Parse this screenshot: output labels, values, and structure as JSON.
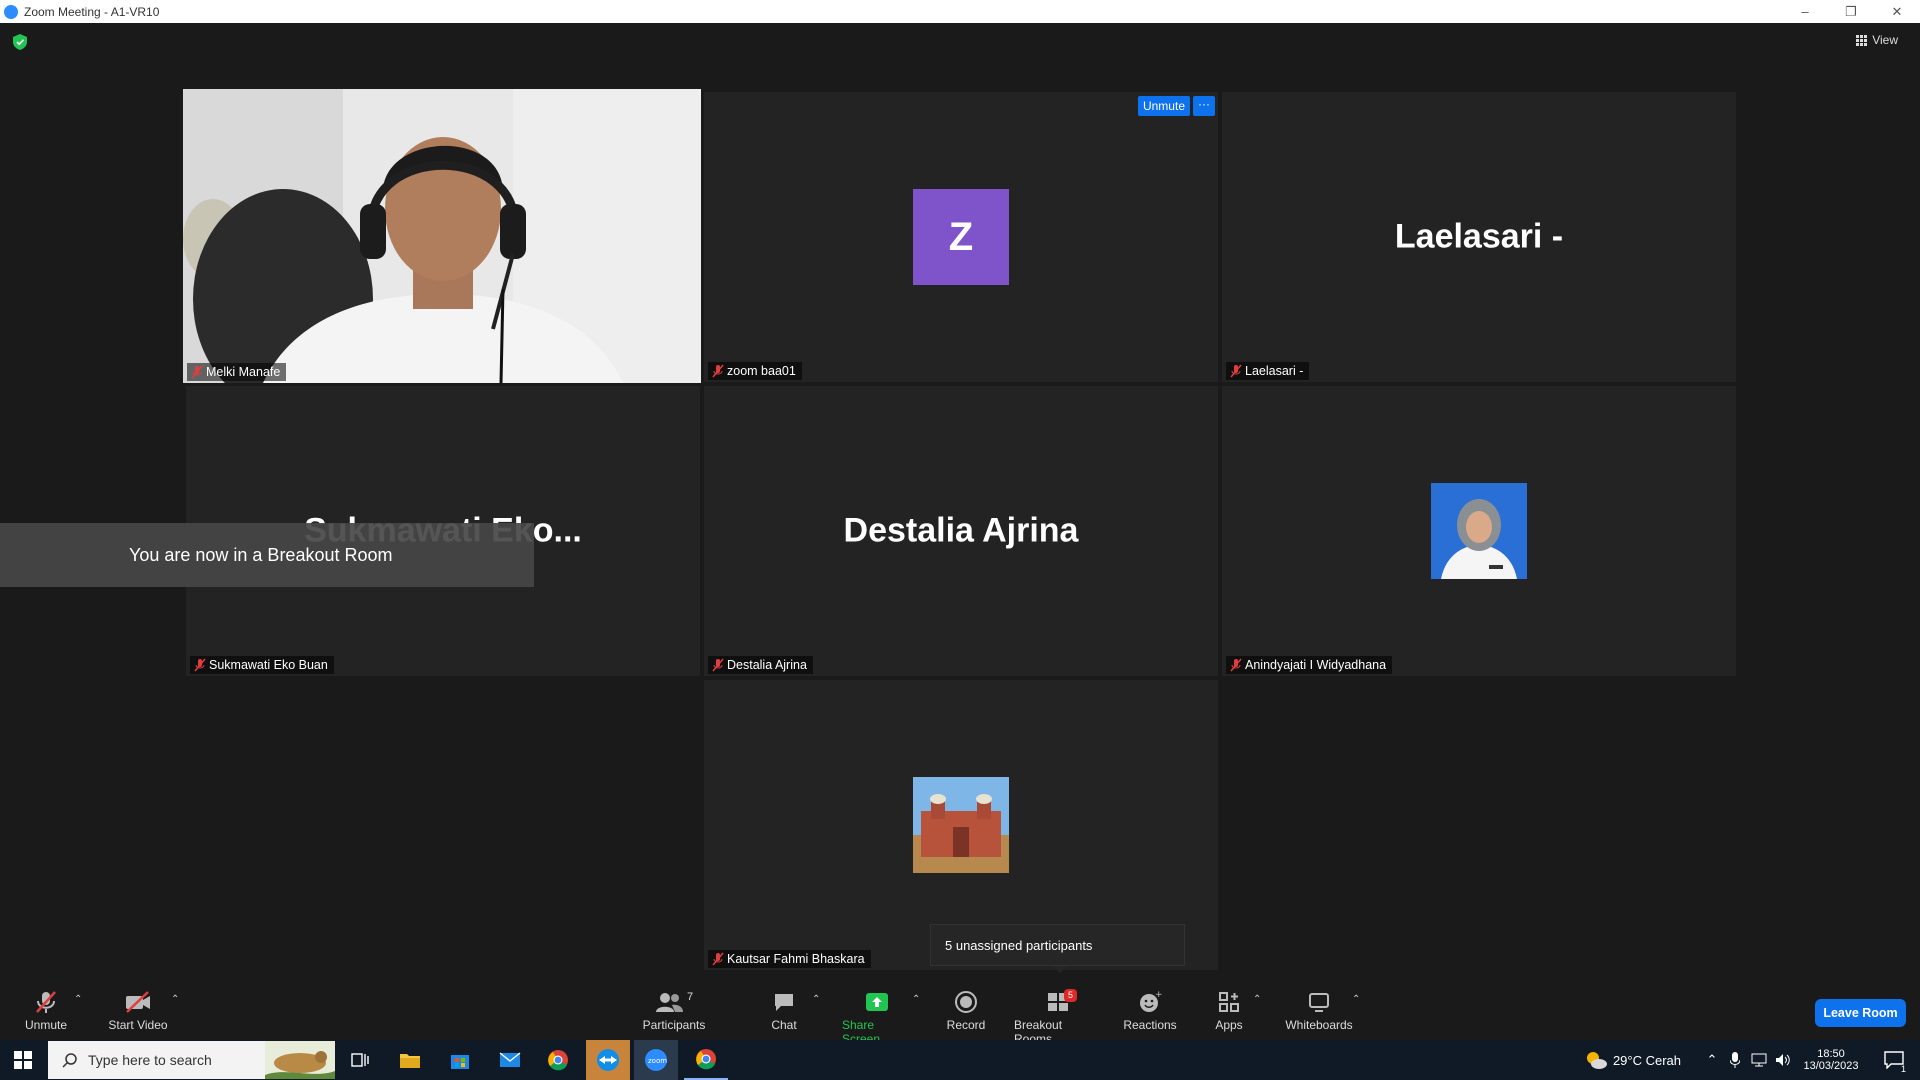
{
  "window": {
    "title": "Zoom Meeting - A1-VR10"
  },
  "topbar": {
    "view_label": "View"
  },
  "tiles": [
    {
      "name": "Melki Manafe"
    },
    {
      "name": "zoom baa01",
      "initial": "Z",
      "unmute_label": "Unmute",
      "more_label": "···"
    },
    {
      "name": "Laelasari -",
      "display_name": "Laelasari -"
    },
    {
      "name": "Sukmawati Eko Buan",
      "display_name": "Sukmawati  Eko..."
    },
    {
      "name": "Destalia Ajrina",
      "display_name": "Destalia Ajrina"
    },
    {
      "name": "Anindyajati I Widyadhana"
    },
    {
      "name": "Kautsar Fahmi Bhaskara"
    }
  ],
  "notices": {
    "breakout": "You are now in a Breakout Room",
    "unassigned": "5 unassigned participants"
  },
  "toolbar": {
    "unmute": "Unmute",
    "start_video": "Start Video",
    "participants": "Participants",
    "participants_count": "7",
    "chat": "Chat",
    "share_screen": "Share Screen",
    "record": "Record",
    "breakout_rooms": "Breakout Rooms",
    "breakout_badge": "5",
    "reactions": "Reactions",
    "apps": "Apps",
    "whiteboards": "Whiteboards",
    "leave_room": "Leave Room",
    "accent": "#0e72ed",
    "share_color": "#23c552"
  },
  "taskbar": {
    "search_placeholder": "Type here to search",
    "weather": "29°C  Cerah",
    "time": "18:50",
    "date": "13/03/2023",
    "notification_count": "1"
  }
}
